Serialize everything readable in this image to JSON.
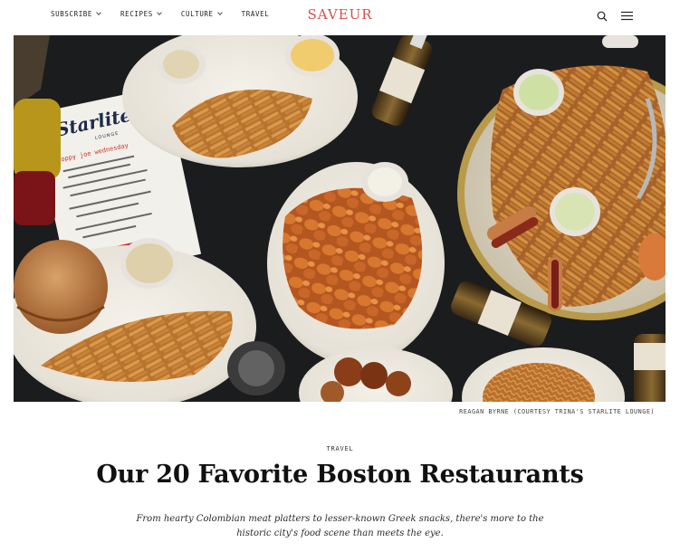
{
  "header": {
    "nav": [
      {
        "label": "SUBSCRIBE",
        "has_dropdown": true
      },
      {
        "label": "RECIPES",
        "has_dropdown": true
      },
      {
        "label": "CULTURE",
        "has_dropdown": true
      },
      {
        "label": "TRAVEL",
        "has_dropdown": false
      }
    ],
    "logo": "SAVEUR",
    "icons": [
      "search-icon",
      "hamburger-menu-icon"
    ]
  },
  "hero": {
    "credit": "REAGAN BYRNE (COURTESY TRINA'S STARLITE LOUNGE)",
    "menu_card": {
      "brand": "Starlite",
      "sub": "LOUNGE",
      "special": "sloppy joe wednesday"
    }
  },
  "article": {
    "category": "TRAVEL",
    "title": "Our 20 Favorite Boston Restaurants",
    "dek": "From hearty Colombian meat platters to lesser-known Greek snacks, there's more to the historic city's food scene than meets the eye."
  },
  "colors": {
    "brand": "#d4504c",
    "text": "#111111",
    "table": "#141516"
  }
}
